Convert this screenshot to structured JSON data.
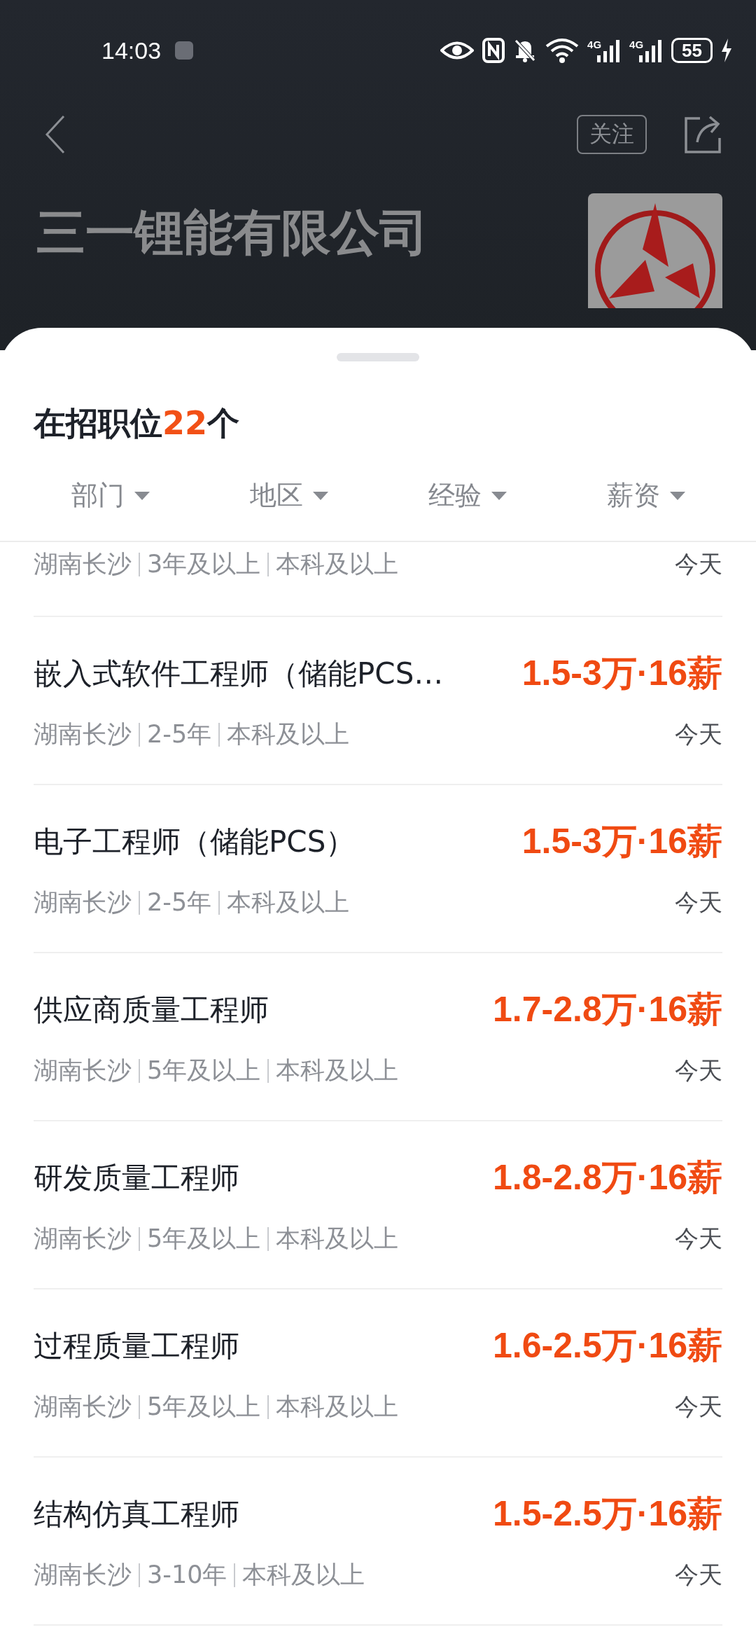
{
  "status_bar": {
    "time": "14:03",
    "signals": [
      "4G",
      "4G"
    ],
    "battery": "55",
    "charging": true
  },
  "header": {
    "follow_label": "关注",
    "company": "三一锂能有限公司"
  },
  "jobs_header": {
    "title": "在招职位**22**个"
  },
  "filters": [
    "部门",
    "地区",
    "经验",
    "薪资"
  ],
  "jobs": [
    {
      "kind": "partial",
      "meta": [
        "湖南长沙",
        "3年及以上",
        "本科及以上"
      ],
      "date": "今天"
    },
    {
      "kind": "full",
      "title": "嵌入式软件工程师（储能PCS…",
      "salary": "1.5-3万·16薪",
      "meta": [
        "湖南长沙",
        "2-5年",
        "本科及以上"
      ],
      "date": "今天"
    },
    {
      "kind": "full",
      "title": "电子工程师（储能PCS）",
      "salary": "1.5-3万·16薪",
      "meta": [
        "湖南长沙",
        "2-5年",
        "本科及以上"
      ],
      "date": "今天"
    },
    {
      "kind": "full",
      "title": "供应商质量工程师",
      "salary": "1.7-2.8万·16薪",
      "meta": [
        "湖南长沙",
        "5年及以上",
        "本科及以上"
      ],
      "date": "今天"
    },
    {
      "kind": "full",
      "title": "研发质量工程师",
      "salary": "1.8-2.8万·16薪",
      "meta": [
        "湖南长沙",
        "5年及以上",
        "本科及以上"
      ],
      "date": "今天"
    },
    {
      "kind": "full",
      "title": "过程质量工程师",
      "salary": "1.6-2.5万·16薪",
      "meta": [
        "湖南长沙",
        "5年及以上",
        "本科及以上"
      ],
      "date": "今天"
    },
    {
      "kind": "full",
      "title": "结构仿真工程师",
      "salary": "1.5-2.5万·16薪",
      "meta": [
        "湖南长沙",
        "3-10年",
        "本科及以上"
      ],
      "date": "今天"
    }
  ]
}
